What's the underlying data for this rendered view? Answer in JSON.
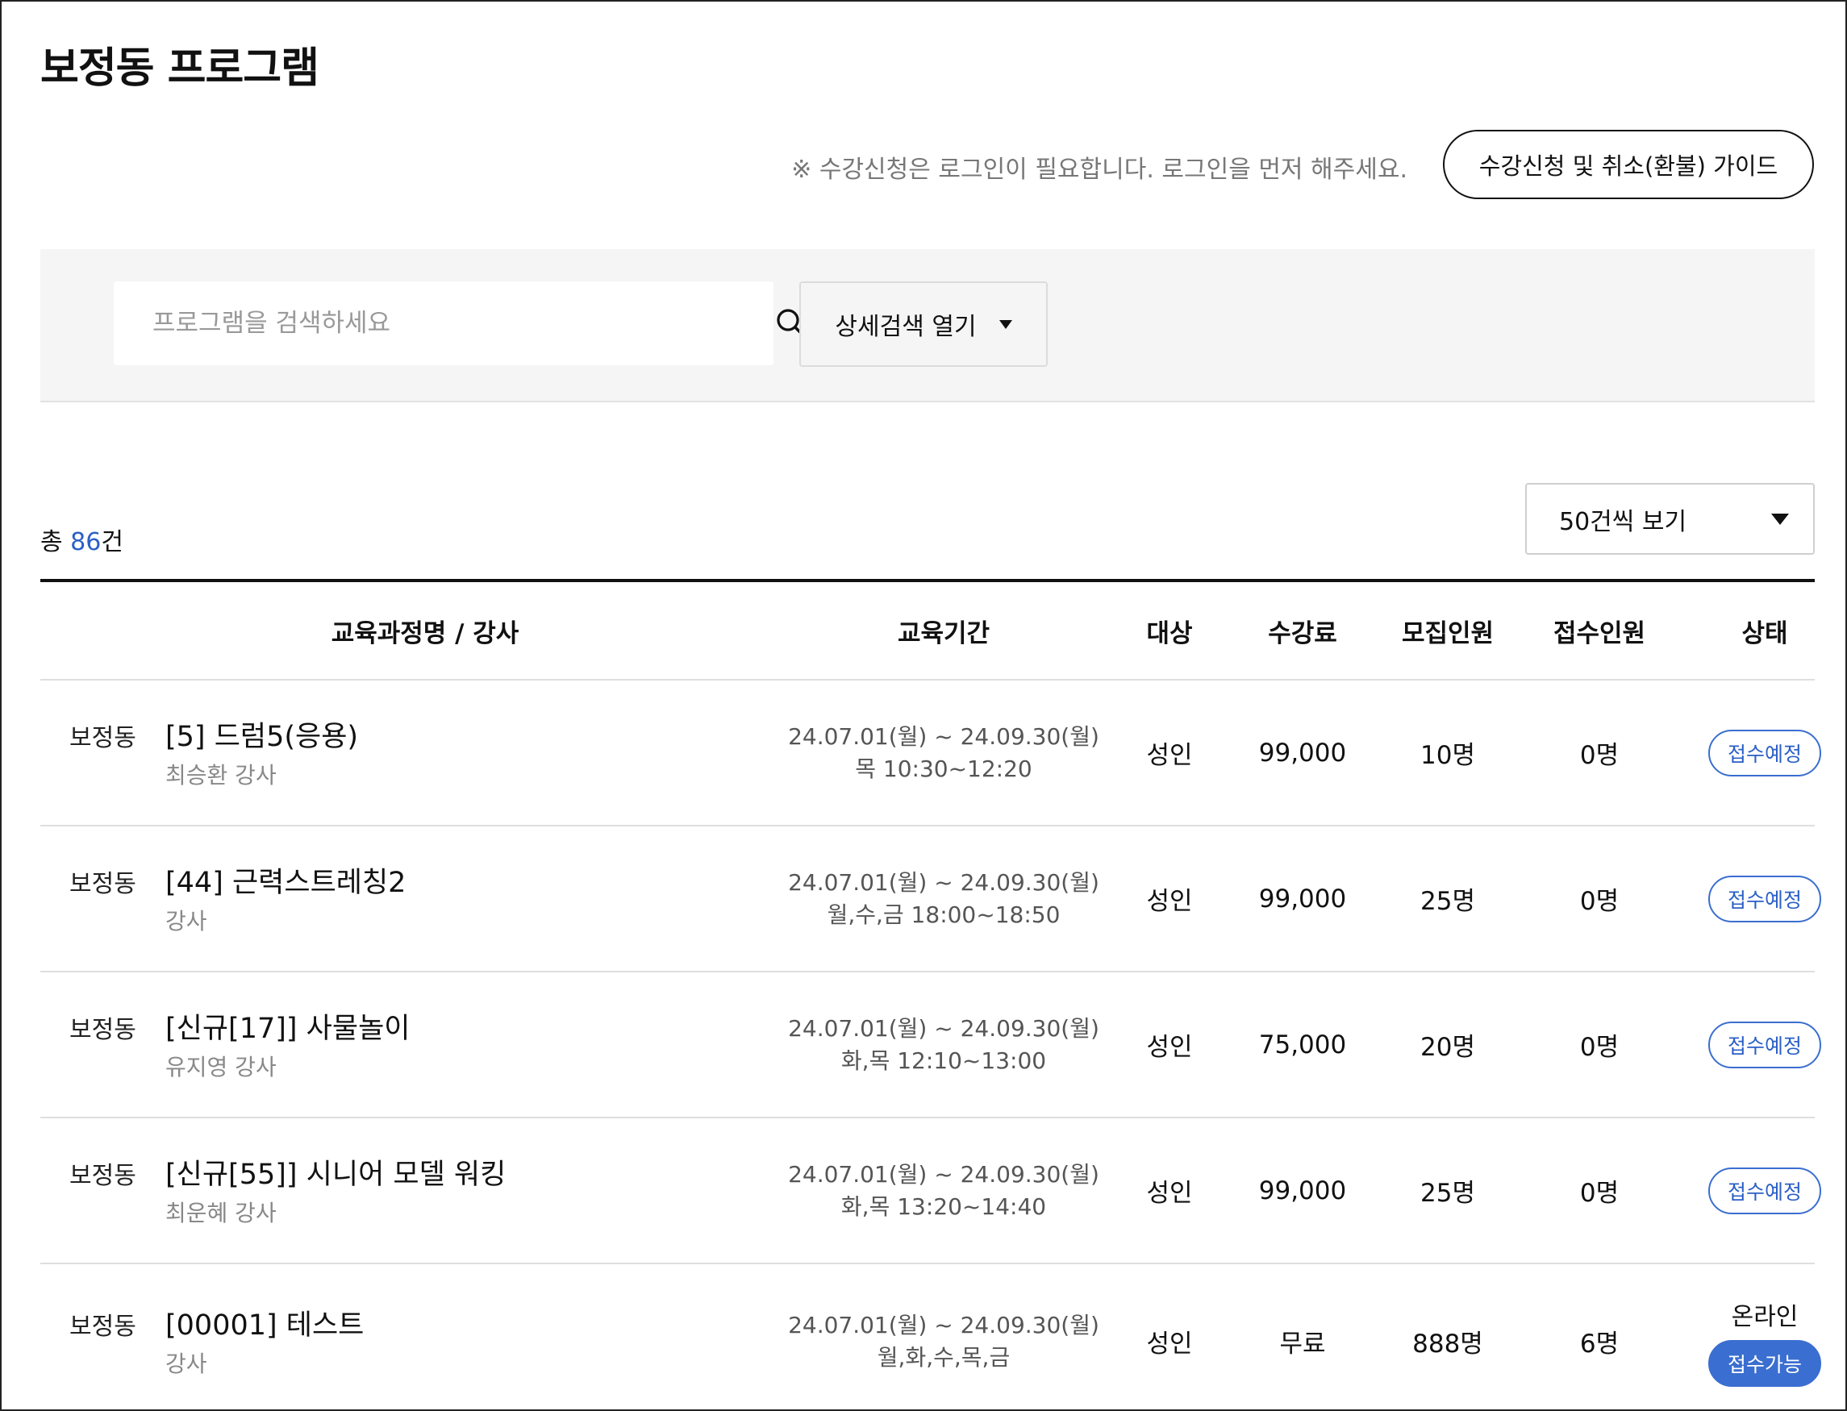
{
  "page": {
    "title": "보정동 프로그램"
  },
  "notice": {
    "login_text": "※ 수강신청은 로그인이 필요합니다. 로그인을 먼저 해주세요.",
    "guide_button_label": "수강신청 및 취소(환불) 가이드"
  },
  "search": {
    "placeholder": "프로그램을 검색하세요",
    "search_icon": "search-icon",
    "detail_toggle_label": "상세검색 열기",
    "detail_toggle_icon": "triangle-down-icon"
  },
  "summary": {
    "total_prefix": "총 ",
    "total_count": "86",
    "total_suffix": "건",
    "page_size_label": "50건씩 보기"
  },
  "table": {
    "headers": {
      "course": "교육과정명 / 강사",
      "period": "교육기간",
      "target": "대상",
      "fee": "수강료",
      "capacity": "모집인원",
      "applicants": "접수인원",
      "status": "상태"
    },
    "rows": [
      {
        "location": "보정동",
        "title": "[5] 드럼5(응용)",
        "teacher": "최승환 강사",
        "date_range": "24.07.01(월) ~ 24.09.30(월)",
        "schedule": "목 10:30~12:20",
        "target": "성인",
        "fee": "99,000",
        "capacity": "10명",
        "applicants": "0명",
        "status_mode": "",
        "status": "접수예정"
      },
      {
        "location": "보정동",
        "title": "[44] 근력스트레칭2",
        "teacher": "강사",
        "date_range": "24.07.01(월) ~ 24.09.30(월)",
        "schedule": "월,수,금 18:00~18:50",
        "target": "성인",
        "fee": "99,000",
        "capacity": "25명",
        "applicants": "0명",
        "status_mode": "",
        "status": "접수예정"
      },
      {
        "location": "보정동",
        "title": "[신규[17]] 사물놀이",
        "teacher": "유지영 강사",
        "date_range": "24.07.01(월) ~ 24.09.30(월)",
        "schedule": "화,목 12:10~13:00",
        "target": "성인",
        "fee": "75,000",
        "capacity": "20명",
        "applicants": "0명",
        "status_mode": "",
        "status": "접수예정"
      },
      {
        "location": "보정동",
        "title": "[신규[55]] 시니어 모델 워킹",
        "teacher": "최운혜 강사",
        "date_range": "24.07.01(월) ~ 24.09.30(월)",
        "schedule": "화,목 13:20~14:40",
        "target": "성인",
        "fee": "99,000",
        "capacity": "25명",
        "applicants": "0명",
        "status_mode": "",
        "status": "접수예정"
      },
      {
        "location": "보정동",
        "title": "[00001] 테스트",
        "teacher": "강사",
        "date_range": "24.07.01(월) ~ 24.09.30(월)",
        "schedule": "월,화,수,목,금",
        "target": "성인",
        "fee": "무료",
        "capacity": "888명",
        "applicants": "6명",
        "status_mode": "온라인",
        "status": "접수가능"
      }
    ]
  },
  "colors": {
    "accent": "#2b5fc7",
    "badge_border": "#3a6ed0",
    "panel_bg": "#f5f5f5",
    "muted_text": "#888888"
  }
}
